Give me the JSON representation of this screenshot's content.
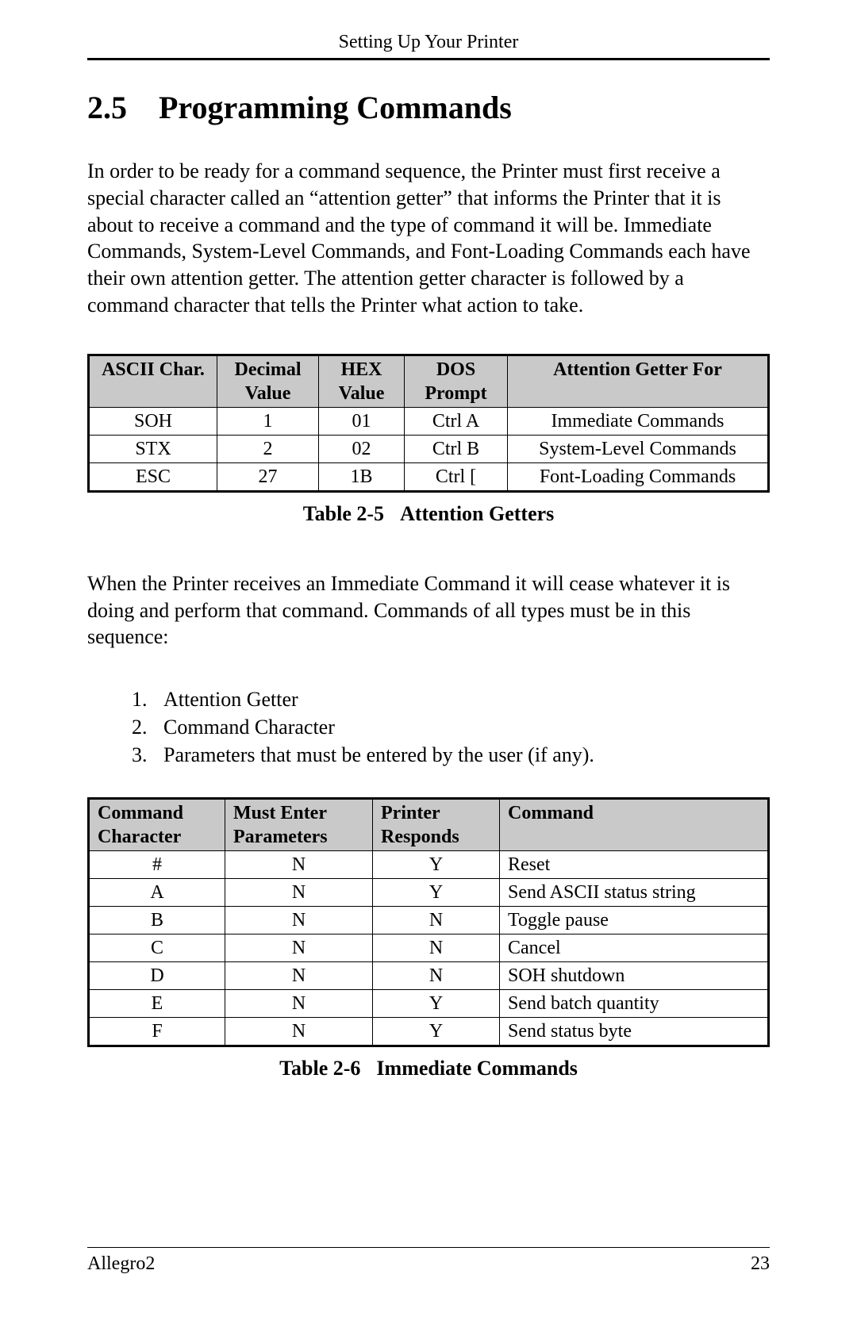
{
  "running_head": "Setting Up Your Printer",
  "section": {
    "number": "2.5",
    "title": "Programming Commands"
  },
  "para1": "In order to be ready for a command sequence, the Printer must first receive a special character called an “attention getter” that informs the Printer that it is about to receive a command and the type of command it will be.  Immediate Commands, System-Level Commands, and Font-Loading Commands each have their own attention getter.  The attention getter character is followed by a command character that tells the Printer what action to take.",
  "table1": {
    "headers": [
      "ASCII Char.",
      "Decimal Value",
      "HEX Value",
      "DOS Prompt",
      "Attention Getter For"
    ],
    "rows": [
      [
        "SOH",
        "1",
        "01",
        "Ctrl A",
        "Immediate Commands"
      ],
      [
        "STX",
        "2",
        "02",
        "Ctrl B",
        "System-Level Commands"
      ],
      [
        "ESC",
        "27",
        "1B",
        "Ctrl [",
        "Font-Loading Commands"
      ]
    ],
    "caption_label": "Table 2-5",
    "caption_title": "Attention Getters"
  },
  "para2": "When the Printer receives an Immediate Command it will cease whatever it is doing and perform that command.  Commands of all types must be in this sequence:",
  "list": [
    "Attention Getter",
    "Command Character",
    "Parameters that must be entered by the user (if any)."
  ],
  "table2": {
    "headers": [
      "Command Character",
      "Must Enter Parameters",
      "Printer Responds",
      "Command"
    ],
    "rows": [
      [
        "#",
        "N",
        "Y",
        "Reset"
      ],
      [
        "A",
        "N",
        "Y",
        "Send ASCII status string"
      ],
      [
        "B",
        "N",
        "N",
        "Toggle pause"
      ],
      [
        "C",
        "N",
        "N",
        "Cancel"
      ],
      [
        "D",
        "N",
        "N",
        "SOH shutdown"
      ],
      [
        "E",
        "N",
        "Y",
        "Send batch quantity"
      ],
      [
        "F",
        "N",
        "Y",
        "Send status byte"
      ]
    ],
    "caption_label": "Table 2-6",
    "caption_title": "Immediate Commands"
  },
  "footer": {
    "left": "Allegro2",
    "right": "23"
  }
}
